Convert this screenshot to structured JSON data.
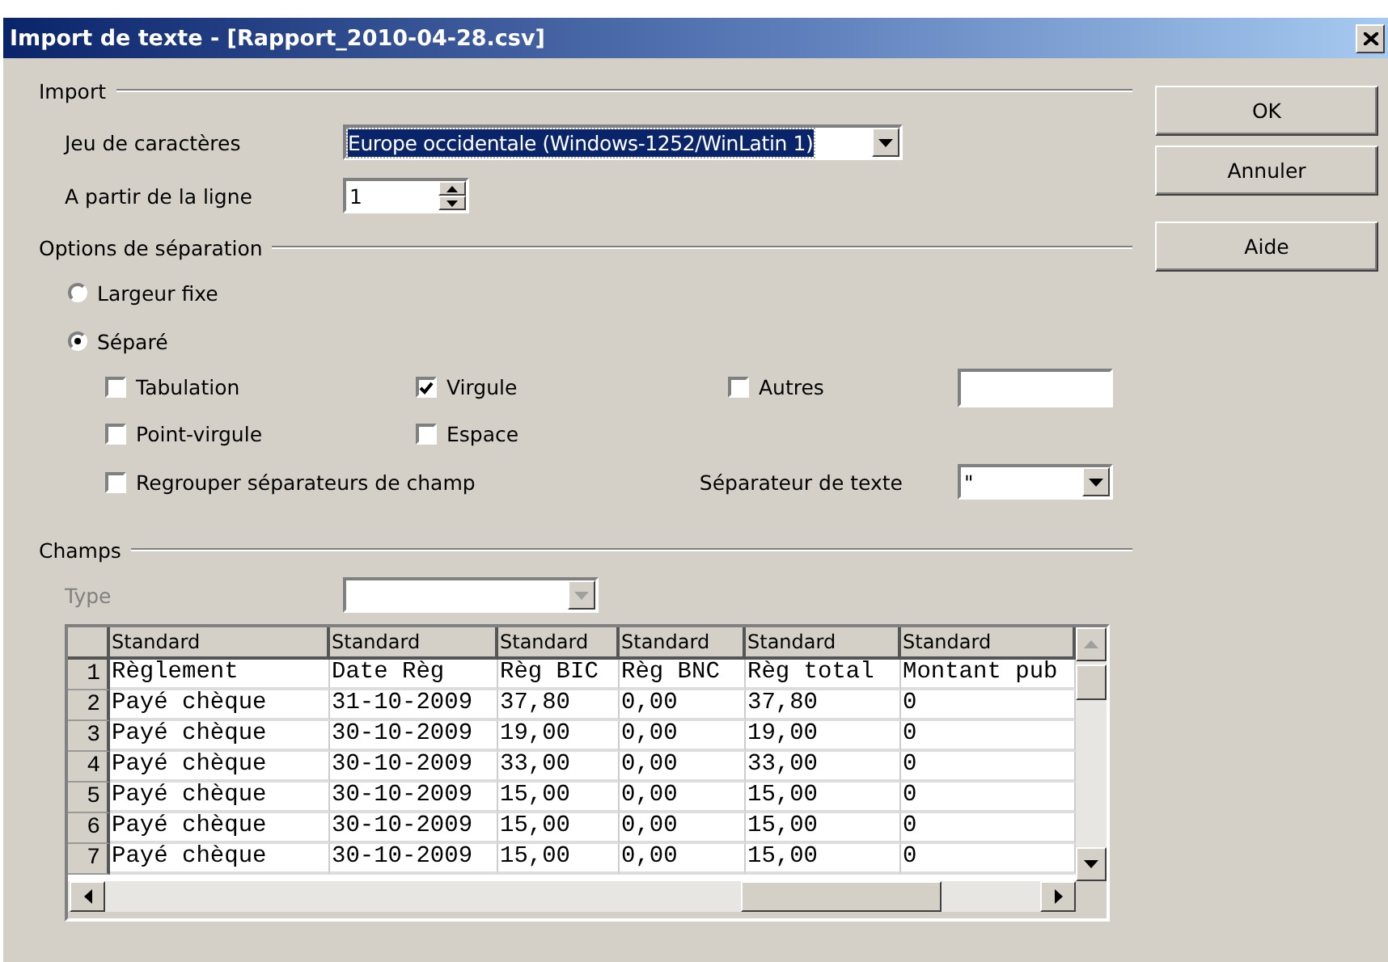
{
  "window": {
    "title": "Import de texte - [Rapport_2010-04-28.csv]"
  },
  "import": {
    "label": "Import",
    "charset": {
      "label": "Jeu de caractères",
      "value": "Europe occidentale (Windows-1252/WinLatin 1)"
    },
    "from_line": {
      "label": "A partir de la ligne",
      "value": "1"
    }
  },
  "separation": {
    "label": "Options de séparation",
    "modes": [
      {
        "label": "Largeur fixe",
        "selected": false
      },
      {
        "label": "Séparé",
        "selected": true
      }
    ],
    "separators": [
      {
        "label": "Tabulation",
        "checked": false
      },
      {
        "label": "Virgule",
        "checked": true
      },
      {
        "label": "Autres",
        "checked": false
      },
      {
        "label": "Point-virgule",
        "checked": false
      },
      {
        "label": "Espace",
        "checked": false
      }
    ],
    "merge": {
      "label": "Regrouper séparateurs de champ",
      "checked": false
    },
    "text_separator": {
      "label": "Séparateur de texte",
      "value": "\""
    }
  },
  "fields": {
    "label": "Champs",
    "type": {
      "label": "Type",
      "disabled": true
    },
    "table": {
      "columns": [
        "Standard",
        "Standard",
        "Standard",
        "Standard",
        "Standard",
        "Standard"
      ],
      "rows": [
        {
          "number": "1",
          "cells": [
            "Règlement",
            "Date Règ",
            "Règ BIC",
            "Règ BNC",
            "Règ total",
            "Montant pub"
          ]
        },
        {
          "number": "2",
          "cells": [
            "Payé chèque",
            "31-10-2009",
            "37,80",
            "0,00",
            "37,80",
            "0"
          ]
        },
        {
          "number": "3",
          "cells": [
            "Payé chèque",
            "30-10-2009",
            "19,00",
            "0,00",
            "19,00",
            "0"
          ]
        },
        {
          "number": "4",
          "cells": [
            "Payé chèque",
            "30-10-2009",
            "33,00",
            "0,00",
            "33,00",
            "0"
          ]
        },
        {
          "number": "5",
          "cells": [
            "Payé chèque",
            "30-10-2009",
            "15,00",
            "0,00",
            "15,00",
            "0"
          ]
        },
        {
          "number": "6",
          "cells": [
            "Payé chèque",
            "30-10-2009",
            "15,00",
            "0,00",
            "15,00",
            "0"
          ]
        },
        {
          "number": "7",
          "cells": [
            "Payé chèque",
            "30-10-2009",
            "15,00",
            "0,00",
            "15,00",
            "0"
          ]
        }
      ]
    }
  },
  "buttons": [
    {
      "label": "OK"
    },
    {
      "label": "Annuler"
    },
    {
      "label": "Aide"
    }
  ]
}
